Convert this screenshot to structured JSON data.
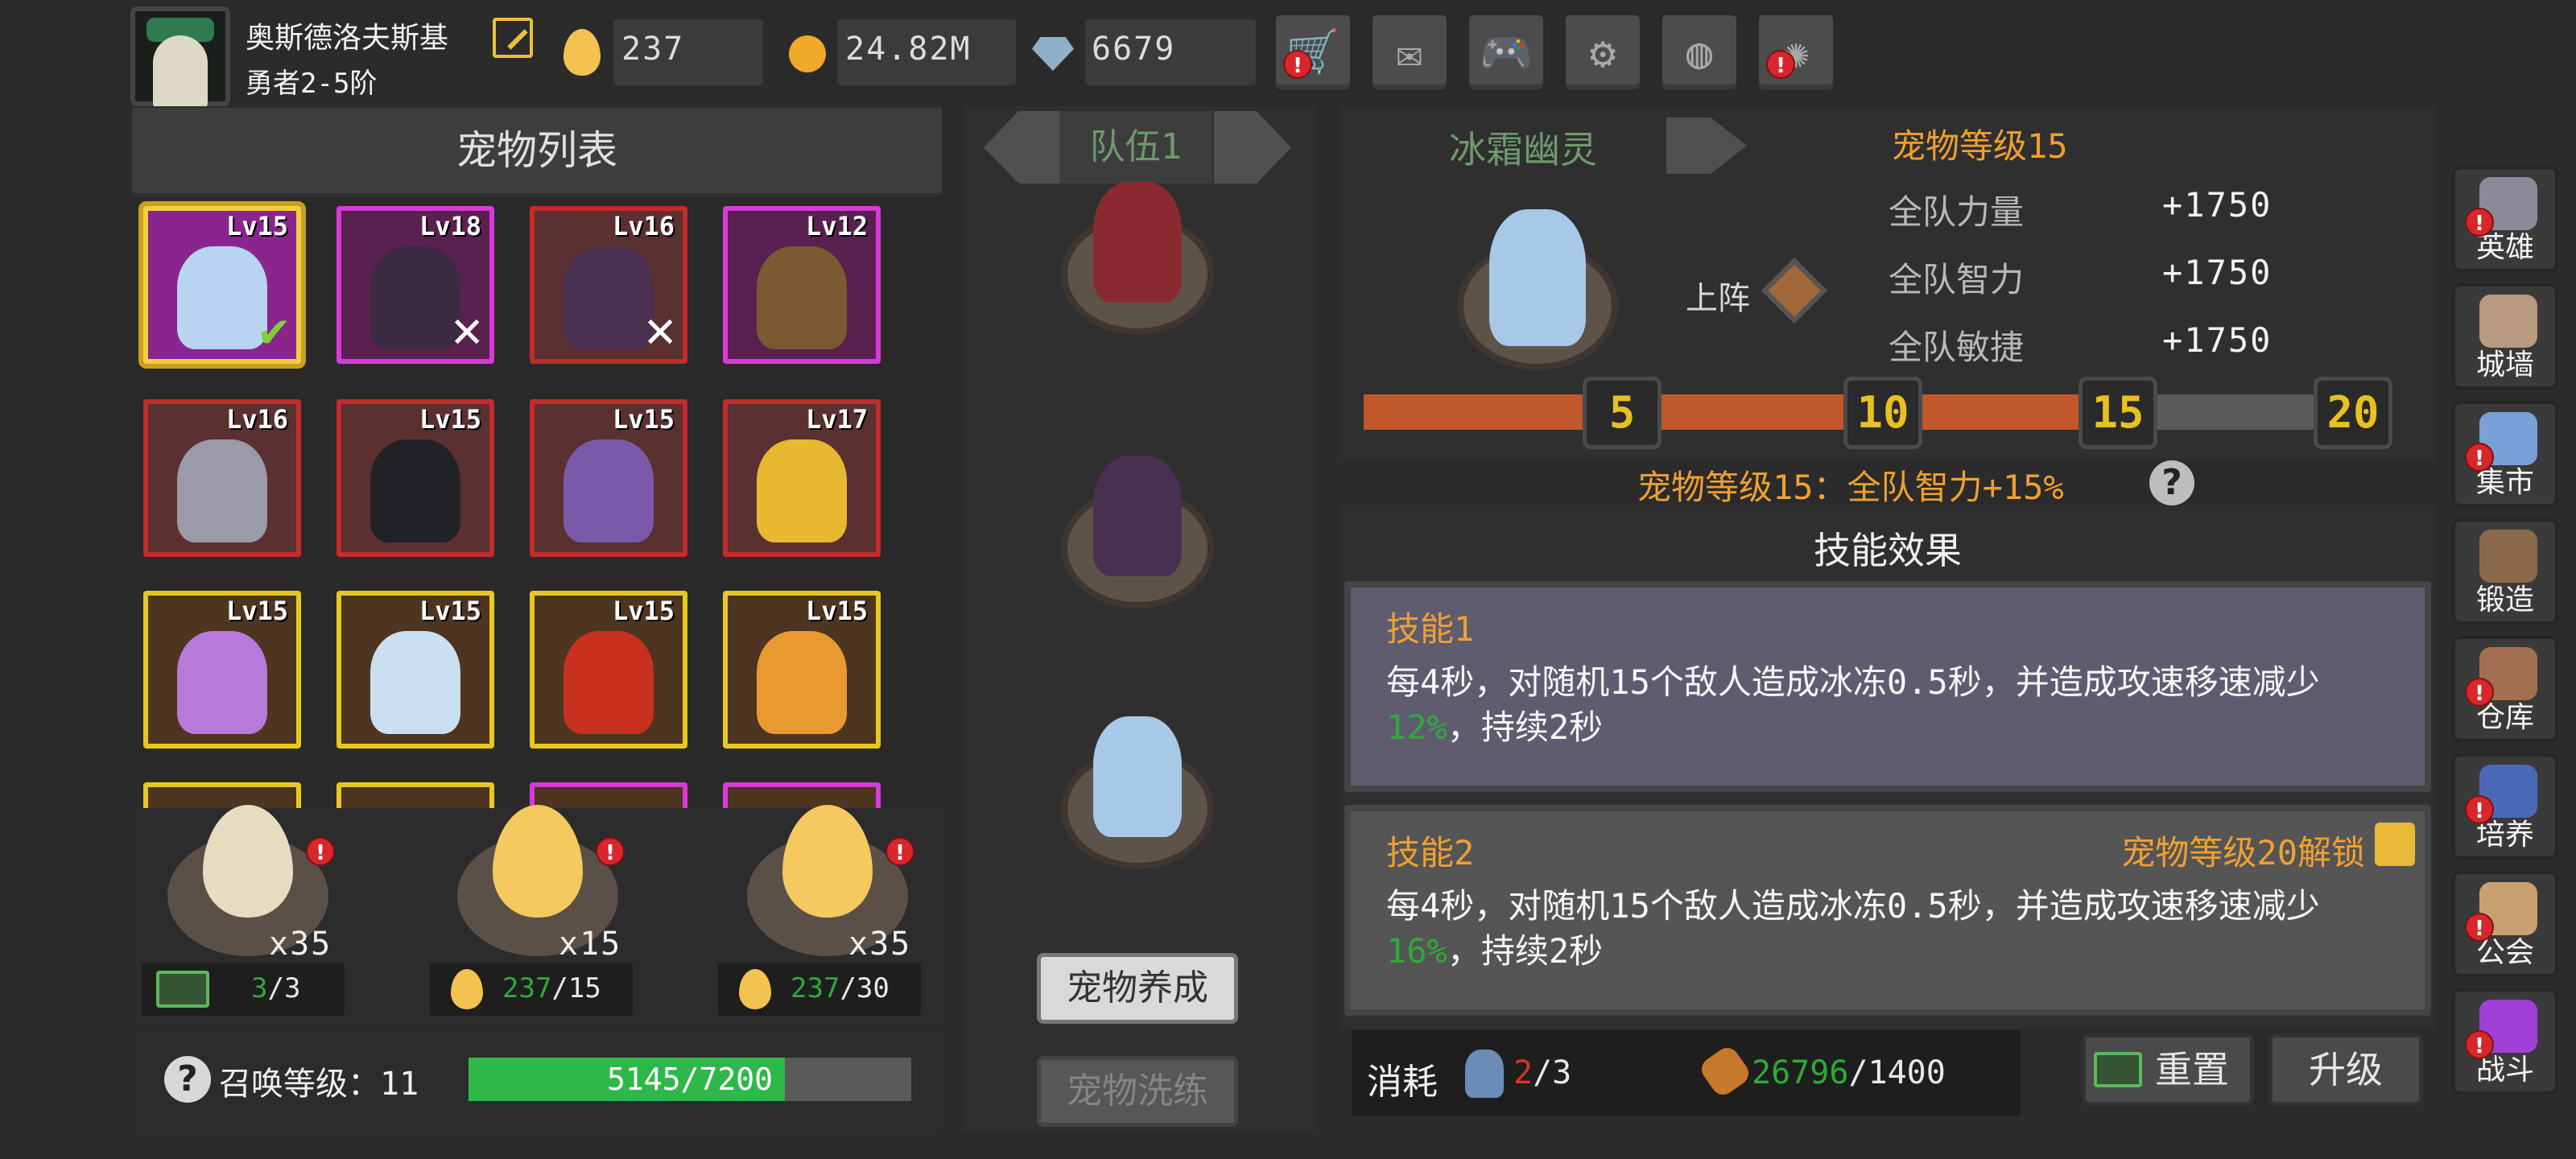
{
  "player": {
    "name": "奥斯德洛夫斯基",
    "rank": "勇者2-5阶"
  },
  "resources": {
    "eggs": "237",
    "gold": "24.82M",
    "gems": "6679"
  },
  "top_buttons": [
    {
      "name": "shop",
      "alert": true
    },
    {
      "name": "mail",
      "alert": false
    },
    {
      "name": "gamepad",
      "alert": false
    },
    {
      "name": "settings",
      "alert": false
    },
    {
      "name": "gallery",
      "alert": false
    },
    {
      "name": "fireworks",
      "alert": true
    }
  ],
  "pet_list": {
    "title": "宠物列表",
    "cards": [
      {
        "lvl": "Lv15",
        "rarity": "selected",
        "mark": "✔",
        "color": "#b8d4f0"
      },
      {
        "lvl": "Lv18",
        "rarity": "pink",
        "mark": "✕",
        "color": "#3a2a44"
      },
      {
        "lvl": "Lv16",
        "rarity": "red",
        "mark": "✕",
        "color": "#4a3050"
      },
      {
        "lvl": "Lv12",
        "rarity": "pink",
        "mark": "",
        "color": "#7a5a30"
      },
      {
        "lvl": "Lv16",
        "rarity": "red",
        "mark": "",
        "color": "#9a9aa8"
      },
      {
        "lvl": "Lv15",
        "rarity": "red",
        "mark": "",
        "color": "#222226"
      },
      {
        "lvl": "Lv15",
        "rarity": "red",
        "mark": "",
        "color": "#7a5aa8"
      },
      {
        "lvl": "Lv17",
        "rarity": "red",
        "mark": "",
        "color": "#e8b830"
      },
      {
        "lvl": "Lv15",
        "rarity": "yellow",
        "mark": "",
        "color": "#b87ad8"
      },
      {
        "lvl": "Lv15",
        "rarity": "yellow",
        "mark": "",
        "color": "#c8e0f0"
      },
      {
        "lvl": "Lv15",
        "rarity": "yellow",
        "mark": "",
        "color": "#c83020"
      },
      {
        "lvl": "Lv15",
        "rarity": "yellow",
        "mark": "",
        "color": "#e89a30"
      }
    ]
  },
  "eggs": [
    {
      "count": "x35",
      "color": "#e8dcc0",
      "info_current": "3",
      "info_total": "/3",
      "info_type": "ad",
      "alert": true
    },
    {
      "count": "x15",
      "color": "#f5c860",
      "info_current": "237",
      "info_total": "/15",
      "info_type": "egg",
      "alert": true
    },
    {
      "count": "x35",
      "color": "#f5c860",
      "info_current": "237",
      "info_total": "/30",
      "info_type": "egg",
      "alert": true
    }
  ],
  "summon": {
    "label": "召唤等级：11",
    "progress_text": "5145/7200",
    "progress": 0.7146
  },
  "team": {
    "title": "队伍1",
    "slots": [
      {
        "color": "#8a2a30"
      },
      {
        "color": "#4a3050"
      },
      {
        "color": "#a8c8e8"
      }
    ],
    "btn_raise": "宠物养成",
    "btn_refine": "宠物洗练"
  },
  "detail": {
    "pet_name": "冰霜幽灵",
    "level_title": "宠物等级15",
    "deploy_label": "上阵",
    "stats": [
      {
        "label": "全队力量",
        "value": "+1750"
      },
      {
        "label": "全队智力",
        "value": "+1750"
      },
      {
        "label": "全队敏捷",
        "value": "+1750"
      }
    ],
    "milestones": [
      "5",
      "10",
      "15",
      "20"
    ],
    "milestone_progress": 0.75,
    "bonus_text": "宠物等级15：全队智力+15%"
  },
  "skills": {
    "title": "技能效果",
    "skill1": {
      "name": "技能1",
      "desc_pre": "每4秒，对随机15个敌人造成冰冻0.5秒，并造成攻速移速减少",
      "desc_val": "12%",
      "desc_post": "，持续2秒"
    },
    "skill2": {
      "name": "技能2",
      "unlock": "宠物等级20解锁",
      "desc_pre": "每4秒，对随机15个敌人造成冰冻0.5秒，并造成攻速移速减少",
      "desc_val": "16%",
      "desc_post": "，持续2秒"
    }
  },
  "cost": {
    "label": "消耗",
    "pet_have": "2",
    "pet_need": "/3",
    "bone_have": "26796",
    "bone_need": "/1400"
  },
  "actions": {
    "reset": "重置",
    "upgrade": "升级"
  },
  "sidebar": [
    {
      "label": "英雄",
      "alert": true,
      "color": "#8a8a9a"
    },
    {
      "label": "城墙",
      "alert": false,
      "color": "#b89a80"
    },
    {
      "label": "集市",
      "alert": true,
      "color": "#7aa0d8"
    },
    {
      "label": "锻造",
      "alert": false,
      "color": "#8a6a4a"
    },
    {
      "label": "仓库",
      "alert": true,
      "color": "#a07050"
    },
    {
      "label": "培养",
      "alert": true,
      "color": "#4a6ab8"
    },
    {
      "label": "公会",
      "alert": true,
      "color": "#c8a070"
    },
    {
      "label": "战斗",
      "alert": true,
      "color": "#a040d8"
    }
  ]
}
